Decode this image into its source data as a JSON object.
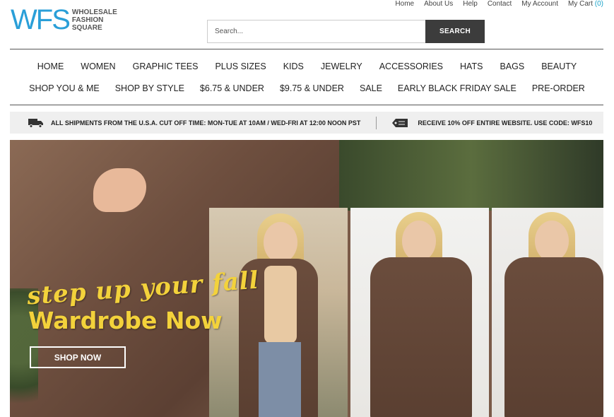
{
  "toplinks": {
    "home": "Home",
    "about": "About Us",
    "help": "Help",
    "contact": "Contact",
    "account": "My Account",
    "cart": "My Cart",
    "cart_count": "(0)"
  },
  "logo": {
    "mark": "WFS",
    "line1": "WHOLESALE",
    "line2": "FASHION",
    "line3": "SQUARE"
  },
  "search": {
    "placeholder": "Search...",
    "button": "SEARCH"
  },
  "nav_row1": [
    "HOME",
    "WOMEN",
    "GRAPHIC TEES",
    "PLUS SIZES",
    "KIDS",
    "JEWELRY",
    "ACCESSORIES",
    "HATS",
    "BAGS",
    "BEAUTY"
  ],
  "nav_row2": [
    "SHOP YOU & ME",
    "SHOP BY STYLE",
    "$6.75 & UNDER",
    "$9.75 & UNDER",
    "SALE",
    "EARLY BLACK FRIDAY SALE",
    "PRE-ORDER"
  ],
  "shipbar": {
    "shipping": "ALL SHIPMENTS FROM THE U.S.A. CUT OFF TIME: MON-TUE AT 10AM / WED-FRI AT 12:00 NOON PST",
    "promo": "RECEIVE 10% OFF ENTIRE WEBSITE. USE CODE: WFS10"
  },
  "hero": {
    "tagline": "step up your fall",
    "headline": "Wardrobe Now",
    "cta": "SHOP NOW"
  },
  "colors": {
    "brand": "#2a9fd8",
    "accent_yellow": "#f3d23b",
    "search_button": "#3c3c3c"
  },
  "icons": {
    "shipping": "truck-icon",
    "promo": "tag-icon"
  }
}
